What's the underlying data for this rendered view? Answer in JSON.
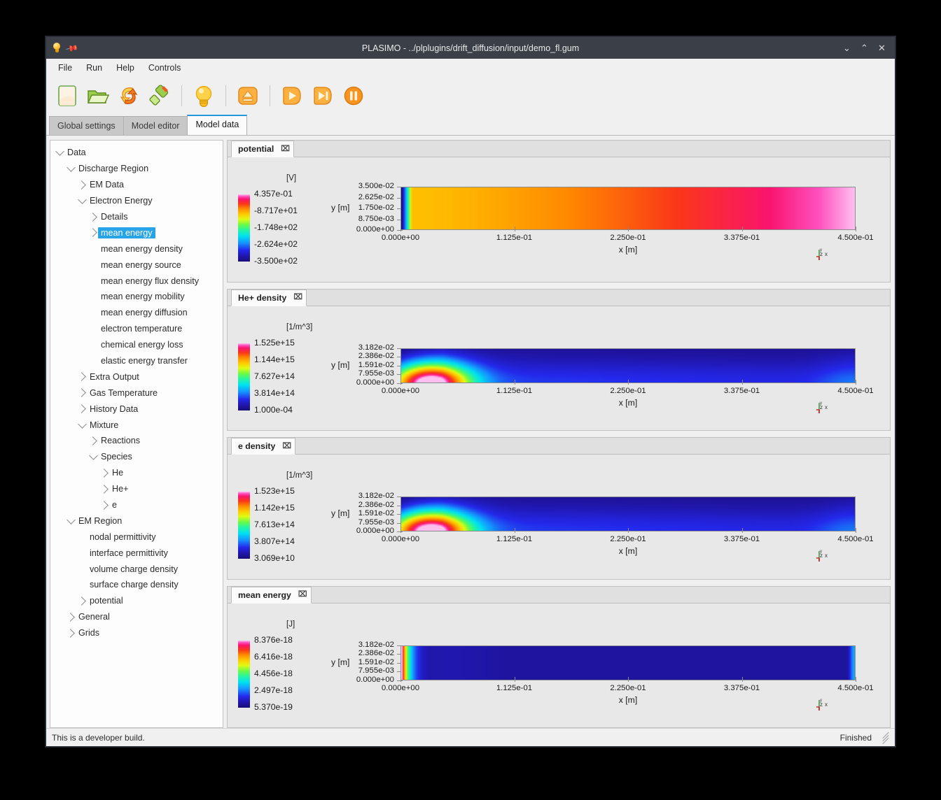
{
  "window": {
    "title": "PLASIMO - ../plplugins/drift_diffusion/input/demo_fl.gum",
    "icon_bulb": "lightbulb-icon",
    "icon_pin": "pin-icon",
    "minimize": "⌄",
    "maximize": "⌃",
    "close": "✕"
  },
  "menu": {
    "items": [
      "File",
      "Run",
      "Help",
      "Controls"
    ]
  },
  "toolbar": {
    "buttons": [
      {
        "name": "new-file-icon",
        "tip": "New"
      },
      {
        "name": "open-folder-icon",
        "tip": "Open"
      },
      {
        "name": "reload-icon",
        "tip": "Reload"
      },
      {
        "name": "highlighter-icon",
        "tip": "Edit"
      },
      {
        "name": "lightbulb-icon",
        "tip": "Hint"
      },
      {
        "name": "eject-icon",
        "tip": "Eject"
      },
      {
        "name": "play-icon",
        "tip": "Run"
      },
      {
        "name": "step-icon",
        "tip": "Step"
      },
      {
        "name": "pause-icon",
        "tip": "Pause"
      }
    ]
  },
  "tabs": {
    "items": [
      "Global settings",
      "Model editor",
      "Model data"
    ],
    "active": "Model data"
  },
  "tree": {
    "items": [
      {
        "label": "Data",
        "depth": 0,
        "toggle": "down",
        "selected": false
      },
      {
        "label": "Discharge Region",
        "depth": 1,
        "toggle": "down",
        "selected": false
      },
      {
        "label": "EM Data",
        "depth": 2,
        "toggle": "right",
        "selected": false
      },
      {
        "label": "Electron Energy",
        "depth": 2,
        "toggle": "down",
        "selected": false
      },
      {
        "label": "Details",
        "depth": 3,
        "toggle": "right",
        "selected": false
      },
      {
        "label": "mean energy",
        "depth": 3,
        "toggle": "right",
        "selected": true
      },
      {
        "label": "mean energy density",
        "depth": 3,
        "toggle": "none",
        "selected": false
      },
      {
        "label": "mean energy source",
        "depth": 3,
        "toggle": "none",
        "selected": false
      },
      {
        "label": "mean energy flux density",
        "depth": 3,
        "toggle": "none",
        "selected": false
      },
      {
        "label": "mean energy mobility",
        "depth": 3,
        "toggle": "none",
        "selected": false
      },
      {
        "label": "mean energy diffusion",
        "depth": 3,
        "toggle": "none",
        "selected": false
      },
      {
        "label": "electron temperature",
        "depth": 3,
        "toggle": "none",
        "selected": false
      },
      {
        "label": "chemical energy loss",
        "depth": 3,
        "toggle": "none",
        "selected": false
      },
      {
        "label": "elastic energy transfer",
        "depth": 3,
        "toggle": "none",
        "selected": false
      },
      {
        "label": "Extra Output",
        "depth": 2,
        "toggle": "right",
        "selected": false
      },
      {
        "label": "Gas Temperature",
        "depth": 2,
        "toggle": "right",
        "selected": false
      },
      {
        "label": "History Data",
        "depth": 2,
        "toggle": "right",
        "selected": false
      },
      {
        "label": "Mixture",
        "depth": 2,
        "toggle": "down",
        "selected": false
      },
      {
        "label": "Reactions",
        "depth": 3,
        "toggle": "right",
        "selected": false
      },
      {
        "label": "Species",
        "depth": 3,
        "toggle": "down",
        "selected": false
      },
      {
        "label": "He",
        "depth": 4,
        "toggle": "right",
        "selected": false
      },
      {
        "label": "He+",
        "depth": 4,
        "toggle": "right",
        "selected": false
      },
      {
        "label": "e",
        "depth": 4,
        "toggle": "right",
        "selected": false
      },
      {
        "label": "EM Region",
        "depth": 1,
        "toggle": "down",
        "selected": false
      },
      {
        "label": "nodal permittivity",
        "depth": 2,
        "toggle": "none",
        "selected": false
      },
      {
        "label": "interface permittivity",
        "depth": 2,
        "toggle": "none",
        "selected": false
      },
      {
        "label": "volume charge density",
        "depth": 2,
        "toggle": "none",
        "selected": false
      },
      {
        "label": "surface charge density",
        "depth": 2,
        "toggle": "none",
        "selected": false
      },
      {
        "label": "potential",
        "depth": 2,
        "toggle": "right",
        "selected": false
      },
      {
        "label": "General",
        "depth": 1,
        "toggle": "right",
        "selected": false
      },
      {
        "label": "Grids",
        "depth": 1,
        "toggle": "right",
        "selected": false
      }
    ]
  },
  "chart_data": [
    {
      "type": "heatmap",
      "tab_label": "potential",
      "close_glyph": "⌧",
      "unit": "[V]",
      "title": "potential",
      "xlabel": "x [m]",
      "ylabel": "y [m]",
      "xticks": [
        "0.000e+00",
        "1.125e-01",
        "2.250e-01",
        "3.375e-01",
        "4.500e-01"
      ],
      "xlim": [
        0,
        0.45
      ],
      "yticks": [
        "0.000e+00",
        "8.750e-03",
        "1.750e-02",
        "2.625e-02",
        "3.500e-02"
      ],
      "ylim": [
        0,
        0.035
      ],
      "colorbar_ticks": [
        "4.357e-01",
        "-8.717e+01",
        "-1.748e+02",
        "-2.624e+02",
        "-3.500e+02"
      ],
      "zlim": [
        -350.0,
        0.4357
      ],
      "colormap": "jet-pink",
      "field": "left-edge-ramp",
      "grid": false,
      "axis_triad": [
        "y",
        "z",
        "x"
      ]
    },
    {
      "type": "heatmap",
      "tab_label": "He+ density",
      "close_glyph": "⌧",
      "unit": "[1/m^3]",
      "title": "He+ density",
      "xlabel": "x [m]",
      "ylabel": "y [m]",
      "xticks": [
        "0.000e+00",
        "1.125e-01",
        "2.250e-01",
        "3.375e-01",
        "4.500e-01"
      ],
      "xlim": [
        0,
        0.45
      ],
      "yticks": [
        "0.000e+00",
        "7.955e-03",
        "1.591e-02",
        "2.386e-02",
        "3.182e-02"
      ],
      "ylim": [
        0,
        0.03182
      ],
      "colorbar_ticks": [
        "1.525e+15",
        "1.144e+15",
        "7.627e+14",
        "3.814e+14",
        "1.000e-04"
      ],
      "zlim": [
        0.0001,
        1525000000000000.0
      ],
      "colormap": "jet-pink",
      "field": "left-blob",
      "grid": false,
      "axis_triad": [
        "y",
        "z",
        "x"
      ]
    },
    {
      "type": "heatmap",
      "tab_label": "e density",
      "close_glyph": "⌧",
      "unit": "[1/m^3]",
      "title": "e density",
      "xlabel": "x [m]",
      "ylabel": "y [m]",
      "xticks": [
        "0.000e+00",
        "1.125e-01",
        "2.250e-01",
        "3.375e-01",
        "4.500e-01"
      ],
      "xlim": [
        0,
        0.45
      ],
      "yticks": [
        "0.000e+00",
        "7.955e-03",
        "1.591e-02",
        "2.386e-02",
        "3.182e-02"
      ],
      "ylim": [
        0,
        0.03182
      ],
      "colorbar_ticks": [
        "1.523e+15",
        "1.142e+15",
        "7.613e+14",
        "3.807e+14",
        "3.069e+10"
      ],
      "zlim": [
        30690000000.0,
        1523000000000000.0
      ],
      "colormap": "jet-pink",
      "field": "left-blob",
      "grid": false,
      "axis_triad": [
        "y",
        "z",
        "x"
      ]
    },
    {
      "type": "heatmap",
      "tab_label": "mean energy",
      "close_glyph": "⌧",
      "unit": "[J]",
      "title": "mean energy",
      "xlabel": "x [m]",
      "ylabel": "y [m]",
      "xticks": [
        "0.000e+00",
        "1.125e-01",
        "2.250e-01",
        "3.375e-01",
        "4.500e-01"
      ],
      "xlim": [
        0,
        0.45
      ],
      "yticks": [
        "0.000e+00",
        "7.955e-03",
        "1.591e-02",
        "2.386e-02",
        "3.182e-02"
      ],
      "ylim": [
        0,
        0.03182
      ],
      "colorbar_ticks": [
        "8.376e-18",
        "6.416e-18",
        "4.456e-18",
        "2.497e-18",
        "5.370e-19"
      ],
      "zlim": [
        5.37e-19,
        8.376e-18
      ],
      "colormap": "jet-pink",
      "field": "left-edge-sharp",
      "grid": false,
      "axis_triad": [
        "y",
        "z",
        "x"
      ]
    }
  ],
  "statusbar": {
    "message": "This is a developer build.",
    "state": "Finished"
  },
  "colors": {
    "accent": "#2196d9",
    "selection": "#27a3e8",
    "titlebar": "#3b4048",
    "panel_bg": "#e8e8e8"
  }
}
